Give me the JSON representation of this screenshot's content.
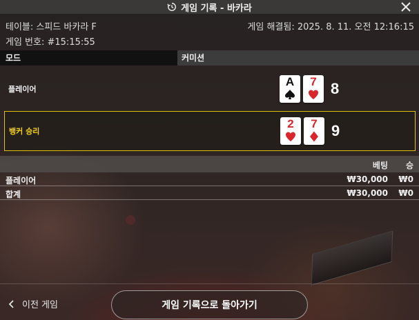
{
  "header": {
    "title": "게임 기록 - 바카라",
    "icon": "history-icon"
  },
  "meta": {
    "table_name": "테이블: 스피드 바카라 F",
    "round_no": "게임 번호: #15:15:55",
    "settled": "게임 해결됨: 2025. 8. 11. 오전 12:16:15"
  },
  "mode_bar": {
    "label": "모드",
    "value": "커미션"
  },
  "hands": {
    "player": {
      "label": "플레이어",
      "cards": [
        {
          "rank": "A",
          "suit": "spade",
          "color": "black"
        },
        {
          "rank": "7",
          "suit": "heart",
          "color": "red"
        }
      ],
      "score": "8"
    },
    "banker": {
      "label": "뱅커 승리",
      "cards": [
        {
          "rank": "2",
          "suit": "heart",
          "color": "red"
        },
        {
          "rank": "7",
          "suit": "diamond",
          "color": "red"
        }
      ],
      "score": "9"
    }
  },
  "bets": {
    "headers": {
      "bet": "베팅",
      "win": "승"
    },
    "rows": [
      {
        "name": "플레이어",
        "bet": "₩30,000",
        "win": "₩0"
      },
      {
        "name": "합계",
        "bet": "₩30,000",
        "win": "₩0"
      }
    ]
  },
  "footer": {
    "prev_label": "이전 게임",
    "back_label": "게임 기록으로 돌아가기"
  },
  "colors": {
    "banker_highlight": "#e0c200",
    "banker_label": "#f2cf1a",
    "card_red": "#d8262c"
  }
}
